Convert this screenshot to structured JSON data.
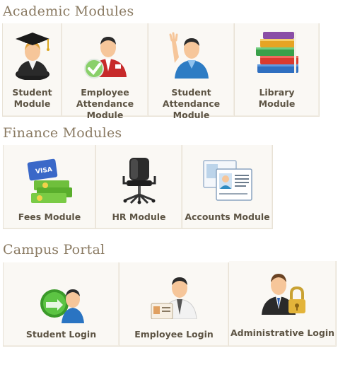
{
  "sections": [
    {
      "title": "Academic Modules",
      "items": [
        {
          "label": "Student\nModule",
          "icon": "graduate-icon"
        },
        {
          "label": "Employee\nAttendance\nModule",
          "icon": "employee-attendance-icon"
        },
        {
          "label": "Student\nAttendance\nModule",
          "icon": "student-attendance-icon"
        },
        {
          "label": "Library\nModule",
          "icon": "books-icon"
        }
      ]
    },
    {
      "title": "Finance Modules",
      "items": [
        {
          "label": "Fees Module",
          "icon": "money-card-icon"
        },
        {
          "label": "HR Module",
          "icon": "office-chair-icon"
        },
        {
          "label": "Accounts Module",
          "icon": "id-cards-icon"
        }
      ]
    },
    {
      "title": "Campus Portal",
      "items": [
        {
          "label": "Student Login",
          "icon": "student-login-icon"
        },
        {
          "label": "Employee Login",
          "icon": "employee-login-icon"
        },
        {
          "label": "Administrative Login",
          "icon": "admin-lock-icon"
        }
      ]
    }
  ]
}
